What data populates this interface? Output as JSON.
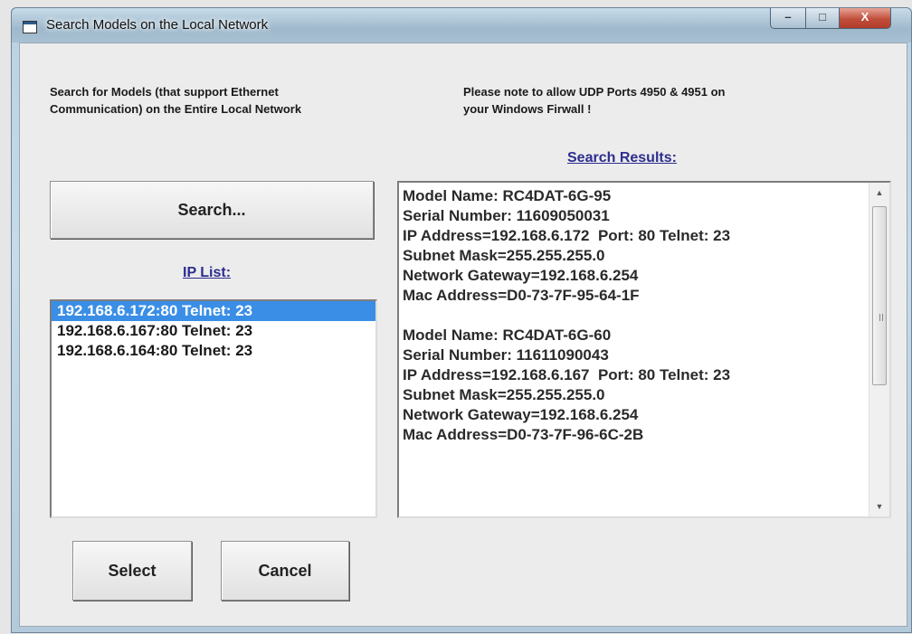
{
  "window": {
    "title": "Search Models on the Local Network",
    "controls": {
      "minimize": "–",
      "maximize": "□",
      "close": "X"
    }
  },
  "description": {
    "line1": "Search for Models (that support Ethernet",
    "line2": "Communication) on the Entire Local Network"
  },
  "note": {
    "line1": "Please note to allow UDP Ports 4950 & 4951 on",
    "line2": "your Windows Firwall !"
  },
  "search_button": "Search...",
  "ip_list": {
    "label": "IP List:",
    "items": [
      "192.168.6.172:80 Telnet: 23",
      "192.168.6.167:80 Telnet: 23",
      "192.168.6.164:80 Telnet: 23"
    ],
    "selected_index": 0
  },
  "search_results": {
    "label": "Search Results:",
    "blocks": [
      {
        "model_name": "Model Name: RC4DAT-6G-95",
        "serial_number": "Serial Number: 11609050031",
        "ip_address": "IP Address=192.168.6.172  Port: 80 Telnet: 23",
        "subnet_mask": "Subnet Mask=255.255.255.0",
        "gateway": "Network Gateway=192.168.6.254",
        "mac_address": "Mac Address=D0-73-7F-95-64-1F"
      },
      {
        "model_name": "Model Name: RC4DAT-6G-60",
        "serial_number": "Serial Number: 11611090043",
        "ip_address": "IP Address=192.168.6.167  Port: 80 Telnet: 23",
        "subnet_mask": "Subnet Mask=255.255.255.0",
        "gateway": "Network Gateway=192.168.6.254",
        "mac_address": "Mac Address=D0-73-7F-96-6C-2B"
      }
    ]
  },
  "buttons": {
    "select": "Select",
    "cancel": "Cancel"
  },
  "colors": {
    "selection": "#3a8ee6",
    "link_label": "#2d2d8f",
    "close_button": "#c14f3c"
  }
}
